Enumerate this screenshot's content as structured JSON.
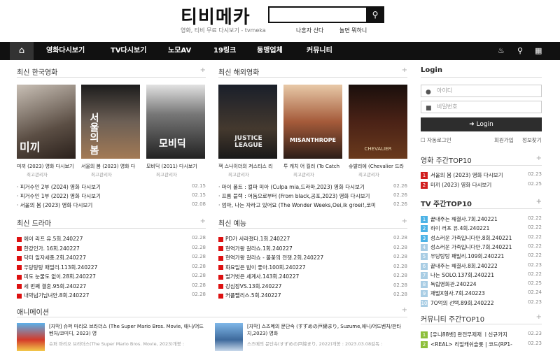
{
  "header": {
    "logo": "티비메카",
    "tagline": "영화, 티비 무료 다시보기 - tvmeka",
    "links": [
      "나혼자 산다",
      "놀면 뭐하니"
    ]
  },
  "nav": {
    "items": [
      "영화다시보기",
      "TV다시보기",
      "노모AV",
      "19링크",
      "동맹업체",
      "커뮤니티"
    ]
  },
  "korean_movies": {
    "title": "최신 한국영화",
    "cards": [
      {
        "title": "미끼 (2023) 영화 다시보기",
        "author": "최고관리자"
      },
      {
        "title": "서울의 봄 (2023) 영화 다",
        "author": "최고관리자"
      },
      {
        "title": "모비딕 (2011) 다시보기",
        "author": "최고관리자"
      }
    ],
    "posters": [
      "미끼",
      "서울의 봄",
      "모비딕"
    ],
    "list": [
      {
        "text": "피거수인 2부 (2024) 영화 다시보기",
        "date": "02.15"
      },
      {
        "text": "피거수인 1부 (2022) 영화 다시보기",
        "date": "02.15"
      },
      {
        "text": "서울의 봄 (2023) 영화 다시보기",
        "date": "02.08"
      }
    ]
  },
  "foreign_movies": {
    "title": "최신 해외영화",
    "cards": [
      {
        "title": "잭 스나이더의 저스티스 리",
        "author": "최고관리자"
      },
      {
        "title": "투 캐치 어 킬러 (To Catch",
        "author": "최고관리자"
      },
      {
        "title": "슈발리에 (Chevalier 드라",
        "author": "최고관리자"
      }
    ],
    "posters": [
      "JUSTICE LEAGUE",
      "MISANTHROPE",
      "CHEVALIER"
    ],
    "list": [
      {
        "text": "마이 폴트 : 컬파 미아 (Culpa mia,드라마,2023) 영화 다시보기",
        "date": "02.26"
      },
      {
        "text": "프롬 블랙 : 어둠으로부터 (From black,공포,2023) 영화 다시보기",
        "date": "02.26"
      },
      {
        "text": "엄마, 나는 자라고 있어요 (The Wonder Weeks,Oei,ik groei!,코미",
        "date": "02.26"
      }
    ]
  },
  "drama": {
    "title": "최신 드라마",
    "list": [
      {
        "text": "에이 리프 유.5회.240227",
        "date": "02.28"
      },
      {
        "text": "한강인가. 16회.240227",
        "date": "02.28"
      },
      {
        "text": "닥터 일자세종.2회.240227",
        "date": "02.28"
      },
      {
        "text": "우당탕탕 패밀리.113회.240227",
        "date": "02.28"
      },
      {
        "text": "피도 눈물도 없이.28회.240227",
        "date": "02.28"
      },
      {
        "text": "세 번째 결혼.95회.240227",
        "date": "02.28"
      },
      {
        "text": "내막넘기남녀안.8회.240227",
        "date": "02.28"
      }
    ]
  },
  "variety": {
    "title": "최신 예능",
    "list": [
      {
        "text": "PD가 사라졌다.1회.240227",
        "date": "02.28"
      },
      {
        "text": "현역가왕 갈라쇼.1회.240227",
        "date": "02.28"
      },
      {
        "text": "현역가왕 갈라쇼 - 불꽃의 전쟁.2회.240227",
        "date": "02.28"
      },
      {
        "text": "화요일은 밤이 좋아.100회.240227",
        "date": "02.28"
      },
      {
        "text": "벌거벗은 세계사.143회.240227",
        "date": "02.28"
      },
      {
        "text": "강심장VS.13회.240227",
        "date": "02.28"
      },
      {
        "text": "커플팰리스.5회.240227",
        "date": "02.28"
      }
    ]
  },
  "animation": {
    "title": "애니메이션",
    "items": [
      {
        "title": "[자막] 슈퍼 마리오 브라더스 (The Super Mario Bros. Movie, 애니/어드벤처/코미디, 2023) 영",
        "sub": "슈퍼 마리오 브라더스(The Super Mario Bros. Movie, 2023)개봉 :"
      },
      {
        "title": "[자막] 스즈메의 문단속 (すずめの戸締まり, Suzume,애니/어드벤처/판타지,2023) 영화",
        "sub": "스즈메의 문단속(すずめの戸締まり, 2022)개봉 : 2023.03.08감독 :"
      }
    ]
  },
  "login": {
    "title": "Login",
    "id_placeholder": "아이디",
    "pw_placeholder": "비밀번호",
    "button": "Login",
    "auto": "자동로그인",
    "join": "회원가입",
    "find": "정보찾기"
  },
  "movie_top": {
    "title": "영화 주간TOP10",
    "list": [
      {
        "rank": "1",
        "text": "서울의 봄 (2023) 영화 다시보기",
        "date": "02.23"
      },
      {
        "rank": "2",
        "text": "미끼 (2023) 영화 다시보기",
        "date": "02.25"
      }
    ]
  },
  "tv_top": {
    "title": "TV 주간TOP10",
    "list": [
      {
        "rank": "1",
        "text": "끝내주는 해결사.7회.240221",
        "date": "02.22"
      },
      {
        "rank": "2",
        "text": "하이 러프 유.4회.240221",
        "date": "02.22"
      },
      {
        "rank": "3",
        "text": "성스러운 가족입니다만.8회.240221",
        "date": "02.22"
      },
      {
        "rank": "4",
        "text": "성스러운 가족입니다만.7회.240221",
        "date": "02.22"
      },
      {
        "rank": "5",
        "text": "우당탕탕 패밀리.109회.240221",
        "date": "02.22"
      },
      {
        "rank": "6",
        "text": "끝내주는 해결사.8회.240222",
        "date": "02.23"
      },
      {
        "rank": "7",
        "text": "나는 SOLO.137회.240221",
        "date": "02.22"
      },
      {
        "rank": "8",
        "text": "독립영화관.240224",
        "date": "02.25"
      },
      {
        "rank": "9",
        "text": "재벌X형사.7회.240223",
        "date": "02.24"
      },
      {
        "rank": "10",
        "text": "7O억의 선택.89회.240222",
        "date": "02.23"
      }
    ]
  },
  "community_top": {
    "title": "커뮤니티 주간TOP10",
    "list": [
      {
        "rank": "1",
        "text": "[유니88벳] 완전무제재 ㅣ신규카지",
        "date": "02.23"
      },
      {
        "rank": "2",
        "text": "<REAL> 리얼캐쉬슬롯 | 코드(RP1-",
        "date": "02.23"
      }
    ]
  },
  "colors": {
    "accent": "#d11f1f",
    "rank_top": "#d11f1f",
    "rank_tv": "#4db3e6",
    "rank_comm": "#8dbf3b",
    "nav_bg": "#111111"
  }
}
